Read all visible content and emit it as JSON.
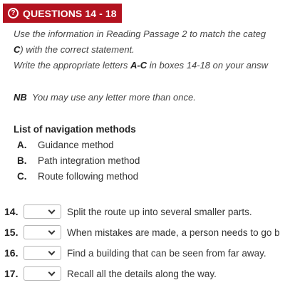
{
  "header": {
    "icon": "help-circle-icon",
    "icon_glyph": "?",
    "title": "QUESTIONS 14 - 18",
    "color": "#b3121f"
  },
  "instructions": {
    "line1": "Use the information in Reading Passage 2 to match the categ",
    "line2_bold": "C",
    "line2_rest": ") with the correct statement.",
    "line3_start": "Write the appropriate letters ",
    "line3_bold": "A-C",
    "line3_end": " in boxes 14-18 on your answ",
    "note_label": "NB",
    "note_text": "You may use any letter more than once."
  },
  "list": {
    "title": "List of navigation methods",
    "items": [
      {
        "letter": "A.",
        "text": "Guidance method"
      },
      {
        "letter": "B.",
        "text": "Path integration method"
      },
      {
        "letter": "C.",
        "text": "Route following method"
      }
    ]
  },
  "questions": [
    {
      "number": "14.",
      "selected": "",
      "text": "Split the route up into several smaller parts."
    },
    {
      "number": "15.",
      "selected": "",
      "text": "When mistakes are made, a person needs to go b"
    },
    {
      "number": "16.",
      "selected": "",
      "text": "Find a building that can be seen from far away."
    },
    {
      "number": "17.",
      "selected": "",
      "text": "Recall all the details along the way."
    }
  ]
}
